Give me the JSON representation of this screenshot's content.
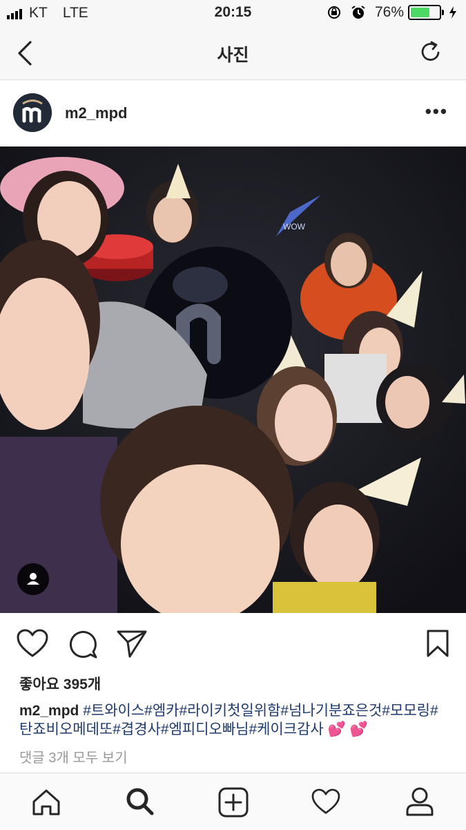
{
  "status_bar": {
    "carrier": "KT",
    "network": "LTE",
    "time": "20:15",
    "battery_percent_label": "76%",
    "battery_level": 0.76
  },
  "nav": {
    "title": "사진",
    "back_icon": "chevron-left-icon",
    "refresh_icon": "refresh-icon"
  },
  "post": {
    "username": "m2_mpd",
    "more_label": "•••",
    "likes": "좋아요 395개",
    "caption_username": "m2_mpd",
    "caption_tags": "#트와이스#엠카#라이키첫일위함#넘나기분죠은것#모모링#탄죠비오메데또#겹경사#엠피디오빠님#케이크감사",
    "caption_emoji": "💕 💕",
    "view_comments": "댓글 3개 모두 보기"
  },
  "photo_text": "WOW",
  "colors": {
    "link": "#1e3a6e",
    "secondary_text": "#999999",
    "battery_green": "#4cd964"
  },
  "tabs": [
    {
      "name": "home",
      "icon": "home-icon"
    },
    {
      "name": "search",
      "icon": "search-icon"
    },
    {
      "name": "add",
      "icon": "add-post-icon"
    },
    {
      "name": "activity",
      "icon": "heart-icon"
    },
    {
      "name": "profile",
      "icon": "profile-icon"
    }
  ]
}
